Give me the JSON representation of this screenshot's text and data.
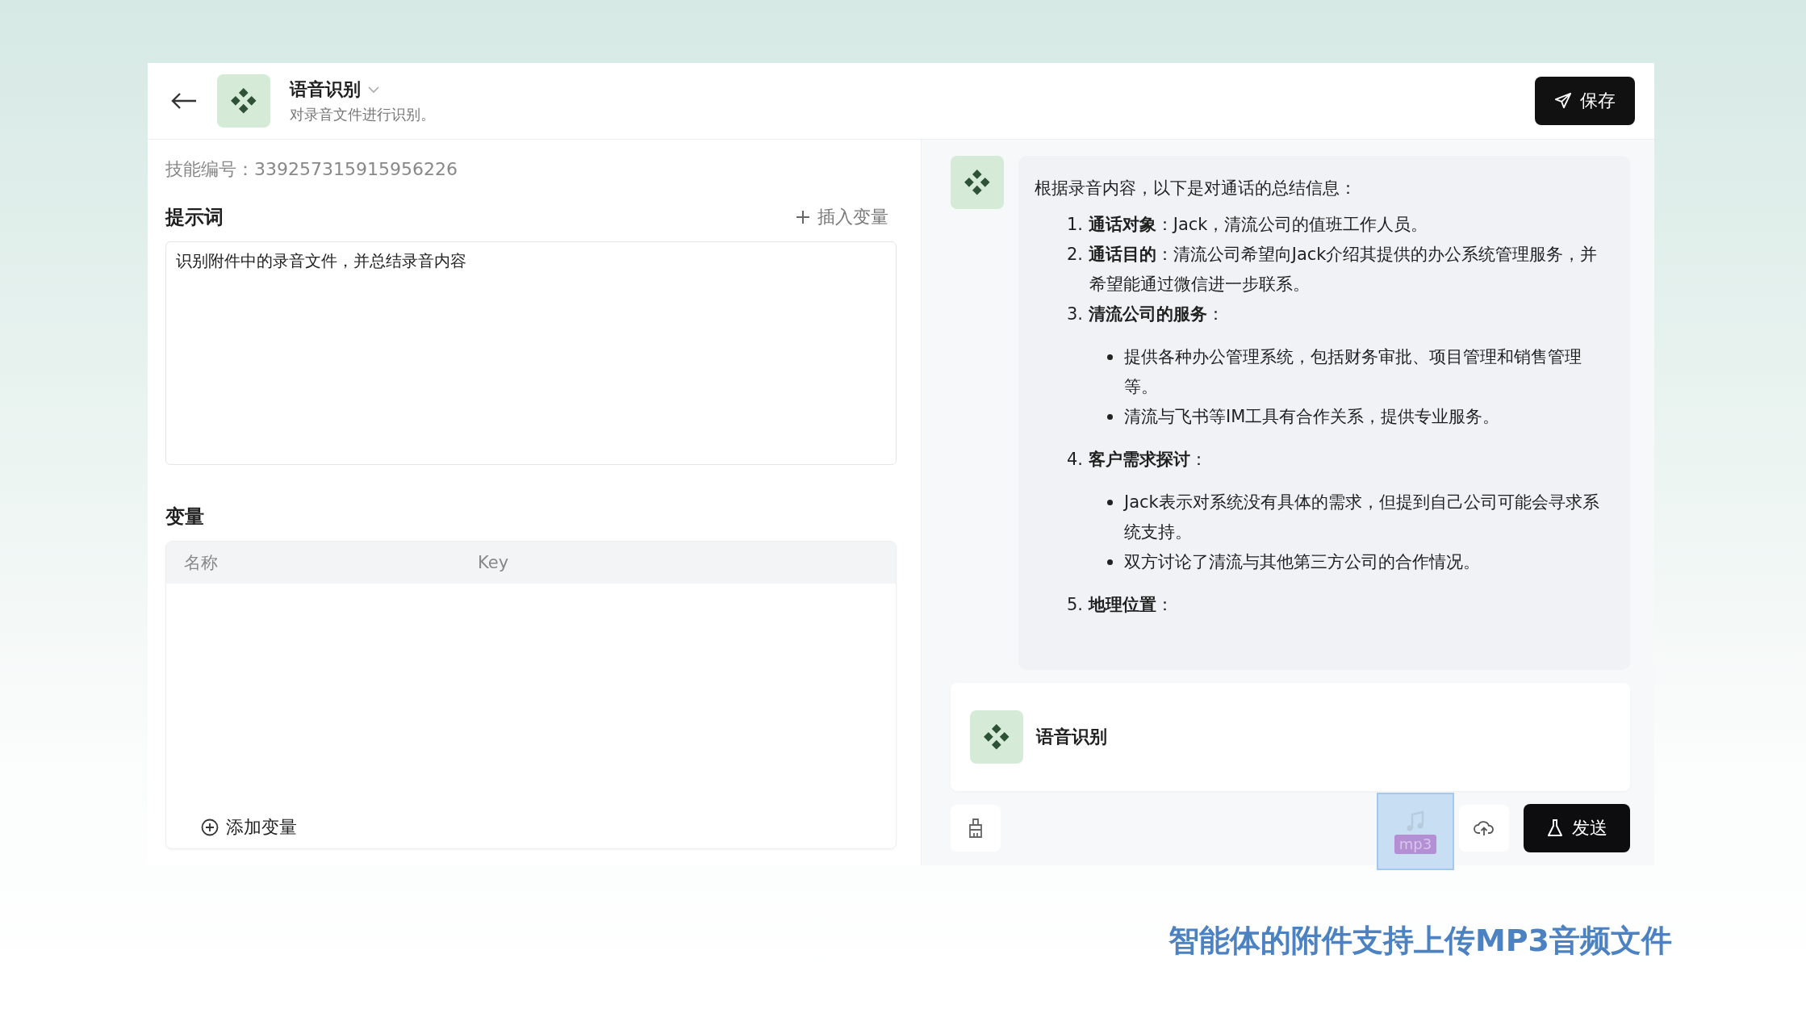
{
  "header": {
    "title": "语音识别",
    "subtitle": "对录音文件进行识别。",
    "save_button": "保存"
  },
  "left": {
    "skill_id_label": "技能编号：",
    "skill_id": "339257315915956226",
    "prompt_title": "提示词",
    "insert_variable": "插入变量",
    "prompt_value": "识别附件中的录音文件，并总结录音内容",
    "variables_title": "变量",
    "columns": [
      "名称",
      "Key"
    ],
    "add_variable": "添加变量"
  },
  "message": {
    "intro": "根据录音内容，以下是对通话的总结信息：",
    "items": [
      {
        "kind": "numbered",
        "text": "1. **通话对象**：Jack，清流公司的值班工作人员。"
      },
      {
        "kind": "numbered",
        "text": "2. **通话目的**：清流公司希望向Jack介绍其提供的办公系统管理服务，并希望能通过微信进一步联系。"
      },
      {
        "kind": "numbered",
        "text": "3. **清流公司的服务**："
      },
      {
        "kind": "bullet",
        "text": "提供各种办公管理系统，包括财务审批、项目管理和销售管理等。"
      },
      {
        "kind": "bullet",
        "text": "清流与飞书等IM工具有合作关系，提供专业服务。"
      },
      {
        "kind": "numbered",
        "text": "4. **客户需求探讨**："
      },
      {
        "kind": "bullet",
        "text": "Jack表示对系统没有具体的需求，但提到自己公司可能会寻求系统支持。"
      },
      {
        "kind": "bullet",
        "text": "双方讨论了清流与其他第三方公司的合作情况。"
      },
      {
        "kind": "numbered",
        "text": "5. **地理位置**："
      }
    ]
  },
  "input": {
    "agent": "语音识别",
    "drag_file": "mp3",
    "send_button": "发送"
  },
  "caption": "智能体的附件支持上传MP3音频文件"
}
